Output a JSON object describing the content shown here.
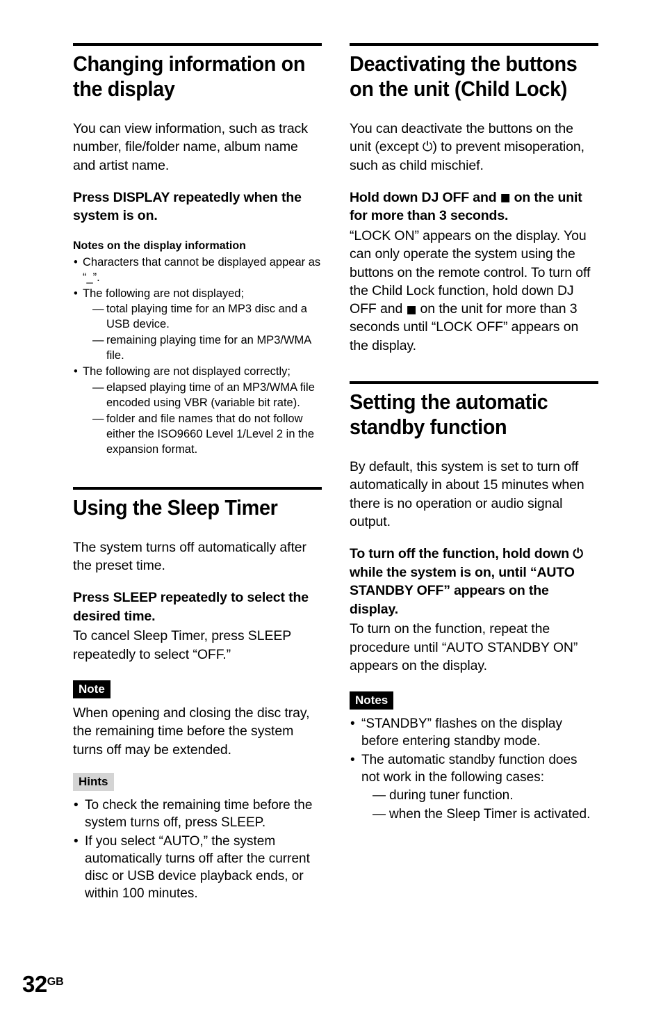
{
  "page": {
    "number": "32",
    "region_suffix": "GB"
  },
  "glyphs": {
    "power": "⏻",
    "stop": "■"
  },
  "left_column": {
    "sections": [
      {
        "id": "changing-information-on-the-display",
        "title": "Changing information on the display",
        "intro": "You can view information, such as track number, file/folder name, album name and artist name.",
        "lead": "Press DISPLAY repeatedly when the system is on.",
        "subhead": "Notes on the display information",
        "notes": [
          {
            "text": "Characters that cannot be displayed appear as “_”.",
            "sub": []
          },
          {
            "text": "The following are not displayed;",
            "sub": [
              "total playing time for an MP3 disc and a USB device.",
              "remaining playing time for an MP3/WMA file."
            ]
          },
          {
            "text": "The following are not displayed correctly;",
            "sub": [
              "elapsed playing time of an MP3/WMA file encoded using VBR (variable bit rate).",
              "folder and file names that do not follow either the ISO9660 Level 1/Level 2 in the expansion format."
            ]
          }
        ]
      },
      {
        "id": "using-the-sleep-timer",
        "title": "Using the Sleep Timer",
        "intro": "The system turns off automatically after the preset time.",
        "lead": "Press SLEEP repeatedly to select the desired time.",
        "lead_body": "To cancel Sleep Timer, press SLEEP repeatedly to select “OFF.”",
        "note_badge": "Note",
        "note_body": "When opening and closing the disc tray, the remaining time before the system turns off may be extended.",
        "hints_badge": "Hints",
        "hints": [
          "To check the remaining time before the system turns off, press SLEEP.",
          "If you select “AUTO,” the system automatically turns off after the current disc or USB device playback ends, or within 100 minutes."
        ]
      }
    ]
  },
  "right_column": {
    "sections": [
      {
        "id": "deactivating-the-buttons-child-lock",
        "title": "Deactivating the buttons on the unit (Child Lock)",
        "intro_part1": "You can deactivate the buttons on the unit (except ",
        "intro_part2": ") to prevent misoperation, such as child mischief.",
        "lead_part1": "Hold down DJ OFF and ",
        "lead_part2": " on the unit for more than 3 seconds.",
        "body_part1": "“LOCK ON” appears on the display. You can only operate the system using the buttons on the remote control. To turn off the Child Lock function, hold down DJ OFF and ",
        "body_part2": " on the unit for more than 3 seconds until “LOCK OFF” appears on the display."
      },
      {
        "id": "setting-the-automatic-standby-function",
        "title": "Setting the automatic standby function",
        "intro": "By default, this system is set to turn off automatically in about 15 minutes when there is no operation or audio signal output.",
        "lead_part1": "To turn off the function, hold down ",
        "lead_part2": " while the system is on, until “AUTO STANDBY OFF” appears on the display.",
        "lead_body": "To turn on the function, repeat the procedure until “AUTO STANDBY ON” appears on the display.",
        "notes_badge": "Notes",
        "notes": [
          {
            "text": "“STANDBY” flashes on the display before entering standby mode.",
            "sub": []
          },
          {
            "text": "The automatic standby function does not work in the following cases:",
            "sub": [
              "during tuner function.",
              "when the Sleep Timer is activated."
            ]
          }
        ]
      }
    ]
  }
}
